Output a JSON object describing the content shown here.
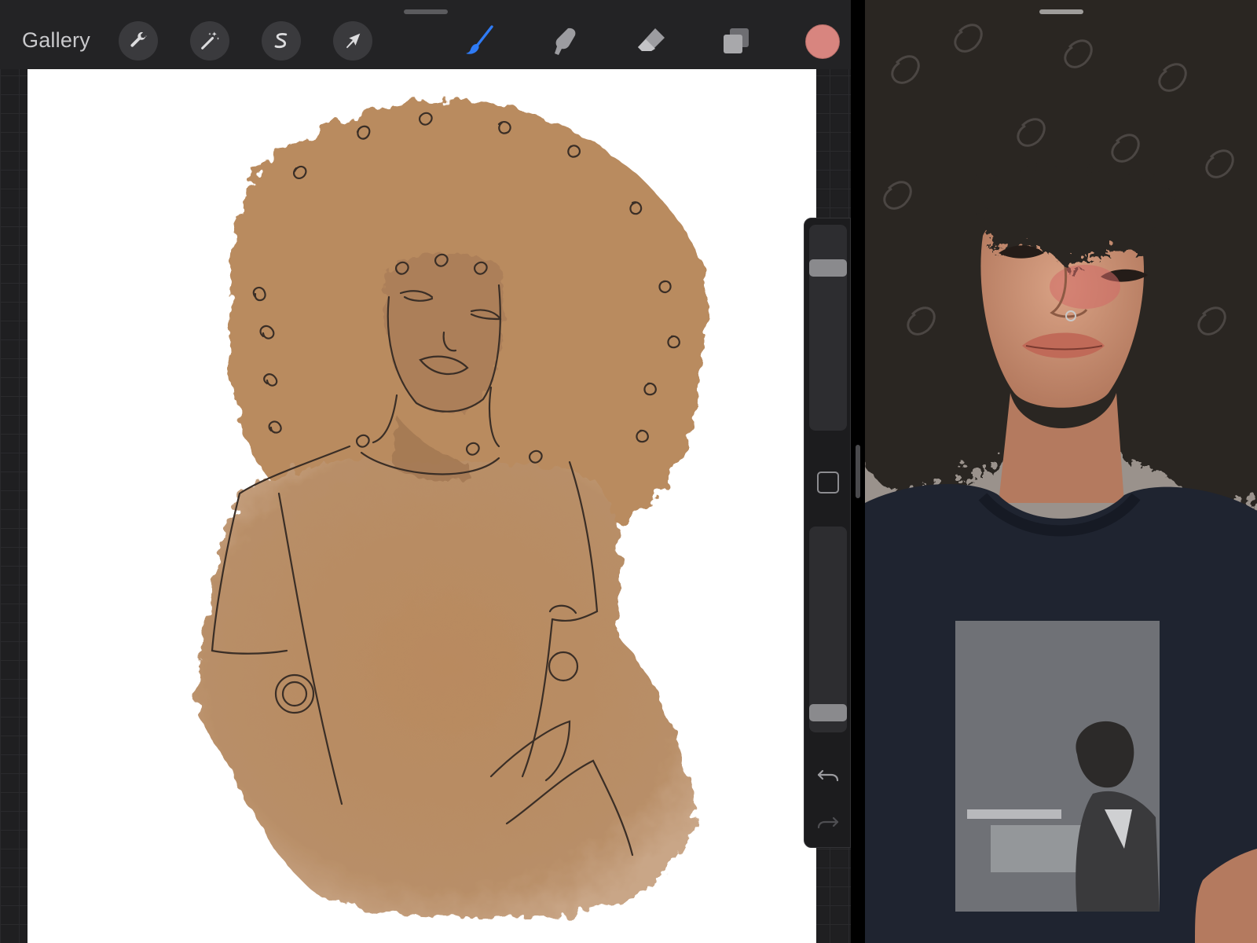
{
  "toolbar": {
    "gallery_label": "Gallery",
    "left_tools": [
      {
        "name": "actions",
        "icon": "wrench-icon"
      },
      {
        "name": "adjustments",
        "icon": "magic-wand-icon"
      },
      {
        "name": "selection",
        "icon": "selection-s-icon"
      },
      {
        "name": "transform",
        "icon": "cursor-arrow-icon"
      }
    ],
    "right_tools": [
      {
        "name": "brush",
        "icon": "paintbrush-icon",
        "active": true
      },
      {
        "name": "smudge",
        "icon": "smudge-finger-icon"
      },
      {
        "name": "eraser",
        "icon": "eraser-icon"
      },
      {
        "name": "layers",
        "icon": "layers-icon"
      }
    ],
    "active_color": "#d8857f",
    "accent_color": "#2f7bf5"
  },
  "sidebar": {
    "brush_size_level": 0.82,
    "brush_opacity_level": 0.05,
    "modify_icon": "square-outline-icon",
    "undo_icon": "undo-arrow-icon",
    "redo_icon": "redo-arrow-icon"
  },
  "canvas": {
    "artwork": "sketch-illustration",
    "skin_tone_color": "#b98c64",
    "line_color": "#3a2e26"
  },
  "reference": {
    "image": "reference-photo"
  }
}
